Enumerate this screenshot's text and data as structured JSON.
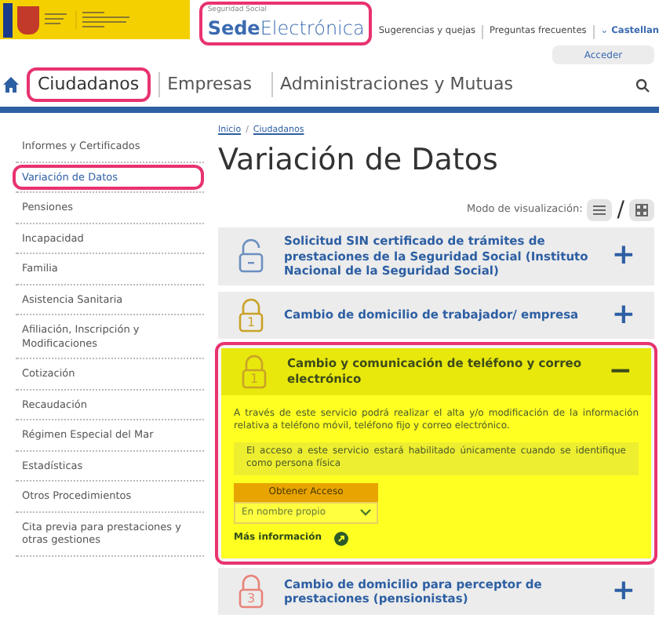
{
  "header": {
    "sede_small": "Seguridad Social",
    "sede_bold": "Sede",
    "sede_light": "Electrónica",
    "sede_highlighted": true,
    "links": [
      "Sugerencias y quejas",
      "Preguntas frecuentes"
    ],
    "language": "Castellan",
    "language_caret": "⌄",
    "login": "Acceder"
  },
  "nav": [
    {
      "label": "Ciudadanos",
      "selected": true,
      "highlighted": true
    },
    {
      "label": "Empresas",
      "selected": false,
      "highlighted": false
    },
    {
      "label": "Administraciones y Mutuas",
      "selected": false,
      "highlighted": false
    }
  ],
  "sidebar": [
    {
      "label": "Informes y Certificados",
      "selected": false,
      "highlighted": false
    },
    {
      "label": "Variación de Datos",
      "selected": true,
      "highlighted": true
    },
    {
      "label": "Pensiones",
      "selected": false,
      "highlighted": false
    },
    {
      "label": "Incapacidad",
      "selected": false,
      "highlighted": false
    },
    {
      "label": "Familia",
      "selected": false,
      "highlighted": false
    },
    {
      "label": "Asistencia Sanitaria",
      "selected": false,
      "highlighted": false
    },
    {
      "label": "Afiliación, Inscripción y Modificaciones",
      "selected": false,
      "highlighted": false
    },
    {
      "label": "Cotización",
      "selected": false,
      "highlighted": false
    },
    {
      "label": "Recaudación",
      "selected": false,
      "highlighted": false
    },
    {
      "label": "Régimen Especial del Mar",
      "selected": false,
      "highlighted": false
    },
    {
      "label": "Estadísticas",
      "selected": false,
      "highlighted": false
    },
    {
      "label": "Otros Procedimientos",
      "selected": false,
      "highlighted": false
    },
    {
      "label": "Cita previa para prestaciones y otras gestiones",
      "selected": false,
      "highlighted": false
    }
  ],
  "breadcrumb": [
    "Inicio",
    "Ciudadanos"
  ],
  "breadcrumb_separator": "/",
  "title": "Variación de Datos",
  "view_mode": {
    "label": "Modo de visualización:",
    "separator": "/"
  },
  "services": [
    {
      "title": "Solicitud SIN certificado de trámites de prestaciones de la Seguridad Social (Instituto Nacional de la Seguridad Social)",
      "kind": "open",
      "color": "#6a8fc0",
      "expanded": false,
      "highlighted": false,
      "toggle": "+"
    },
    {
      "title": "Cambio de domicilio de trabajador/ empresa",
      "kind": "locked",
      "lock_level": "1",
      "color": "#c9a227",
      "expanded": false,
      "highlighted": false,
      "toggle": "+"
    },
    {
      "title": "Cambio y comunicación de teléfono y correo electrónico",
      "kind": "locked",
      "lock_level": "1",
      "color": "#c9a227",
      "expanded": true,
      "highlighted": true,
      "toggle": "−",
      "description": "A través de este servicio podrá realizar el alta y/o modificación de la información relativa a teléfono móvil, teléfono fijo y correo electrónico.",
      "notice": "El acceso a este servicio estará habilitado únicamente cuando se identifique como persona física",
      "access_header": "Obtener Acceso",
      "access_option": "En nombre propio",
      "more_info": "Más información"
    },
    {
      "title": "Cambio de domicilio para perceptor de prestaciones (pensionistas)",
      "kind": "locked",
      "lock_level": "3",
      "color": "#e8837a",
      "expanded": false,
      "highlighted": false,
      "toggle": "+"
    }
  ]
}
